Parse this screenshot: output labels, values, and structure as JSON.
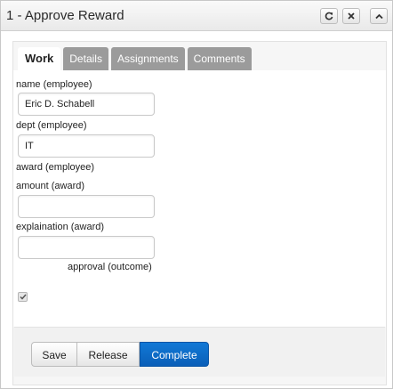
{
  "header": {
    "title": "1 - Approve Reward",
    "buttons": [
      {
        "name": "refresh",
        "icon": "refresh-icon"
      },
      {
        "name": "close",
        "icon": "close-icon"
      },
      {
        "name": "collapse",
        "icon": "chevron-up-icon"
      }
    ]
  },
  "tabs": [
    {
      "label": "Work",
      "active": true
    },
    {
      "label": "Details",
      "active": false
    },
    {
      "label": "Assignments",
      "active": false
    },
    {
      "label": "Comments",
      "active": false
    }
  ],
  "form": {
    "name_label": "name (employee)",
    "name_value": "Eric D. Schabell",
    "dept_label": "dept (employee)",
    "dept_value": "IT",
    "award_label": "award (employee)",
    "amount_label": "amount (award)",
    "amount_value": "",
    "explanation_label": "explaination (award)",
    "explanation_value": "",
    "approval_label": "approval (outcome)",
    "approval_checked": true
  },
  "actions": {
    "save": "Save",
    "release": "Release",
    "complete": "Complete"
  },
  "colors": {
    "primary": "#0a5fb8",
    "tab_inactive": "#9b9b9b"
  }
}
